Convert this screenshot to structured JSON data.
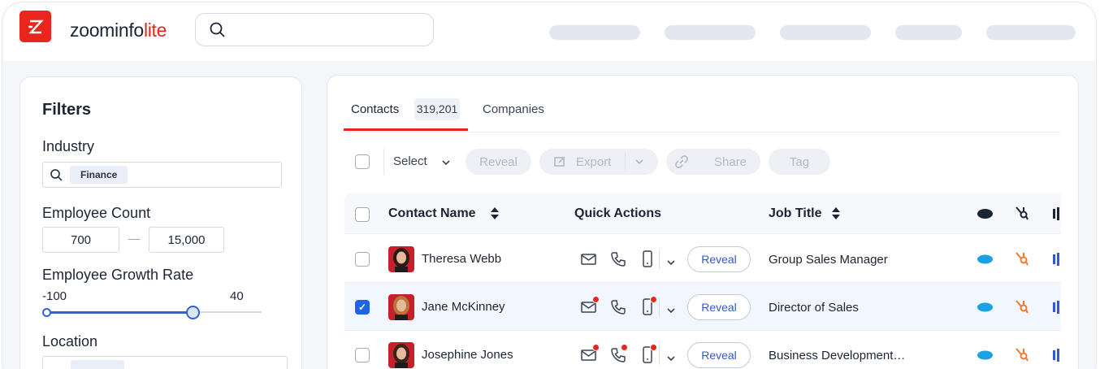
{
  "brand": {
    "name_main": "zoominfo",
    "name_accent": "lite",
    "color": "#e8261e"
  },
  "filters": {
    "title": "Filters",
    "industry": {
      "label": "Industry",
      "chip": "Finance"
    },
    "employee_count": {
      "label": "Employee Count",
      "min": "700",
      "separator": "—",
      "max": "15,000"
    },
    "growth_rate": {
      "label": "Employee Growth Rate",
      "min_label": "-100",
      "max_label": "40",
      "value_fraction": 0.68
    },
    "location": {
      "label": "Location"
    }
  },
  "tabs": {
    "contacts_label": "Contacts",
    "contacts_count": "319,201",
    "companies_label": "Companies"
  },
  "toolbar": {
    "select": "Select",
    "reveal": "Reveal",
    "export": "Export",
    "share": "Share",
    "tag": "Tag"
  },
  "table": {
    "headers": {
      "name": "Contact Name",
      "actions": "Quick Actions",
      "job": "Job Title"
    },
    "rows": [
      {
        "name": "Theresa Webb",
        "job": "Group Sales Manager",
        "reveal": "Reveal",
        "checked": false,
        "hair": "#2b1a14"
      },
      {
        "name": "Jane McKinney",
        "job": "Director of Sales",
        "reveal": "Reveal",
        "checked": true,
        "hair": "#b7753a"
      },
      {
        "name": "Josephine Jones",
        "job": "Business Development…",
        "reveal": "Reveal",
        "checked": false,
        "hair": "#3a2218"
      }
    ]
  },
  "colors": {
    "salesforce": "#1ba2e0",
    "hubspot": "#f07a2e",
    "accent_blue": "#3457d5"
  }
}
